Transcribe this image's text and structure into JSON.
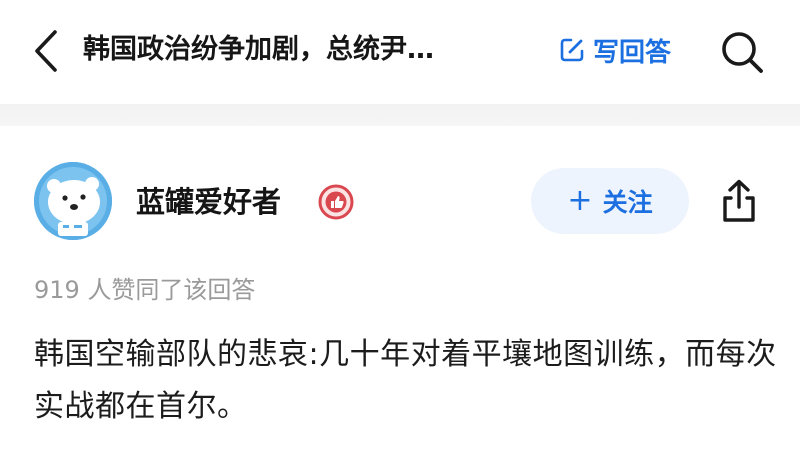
{
  "header": {
    "question_title": "韩国政治纷争加剧，总统尹…",
    "write_answer_label": "写回答"
  },
  "author": {
    "name": "蓝罐爱好者",
    "follow_label": "关注",
    "follow_plus": "+"
  },
  "answer": {
    "likes_text": "919 人赞同了该回答",
    "content": "韩国空输部队的悲哀:几十年对着平壤地图训练，而每次实战都在首尔。"
  },
  "colors": {
    "accent": "#1b6fe0",
    "follow_bg": "#eef4fd",
    "muted_text": "#9a9a9a",
    "badge_red": "#d9474f"
  },
  "icons": {
    "back": "chevron-left-icon",
    "write": "edit-icon",
    "search": "search-icon",
    "badge": "thumbs-up-badge-icon",
    "share": "share-icon",
    "avatar": "polar-bear-avatar"
  }
}
